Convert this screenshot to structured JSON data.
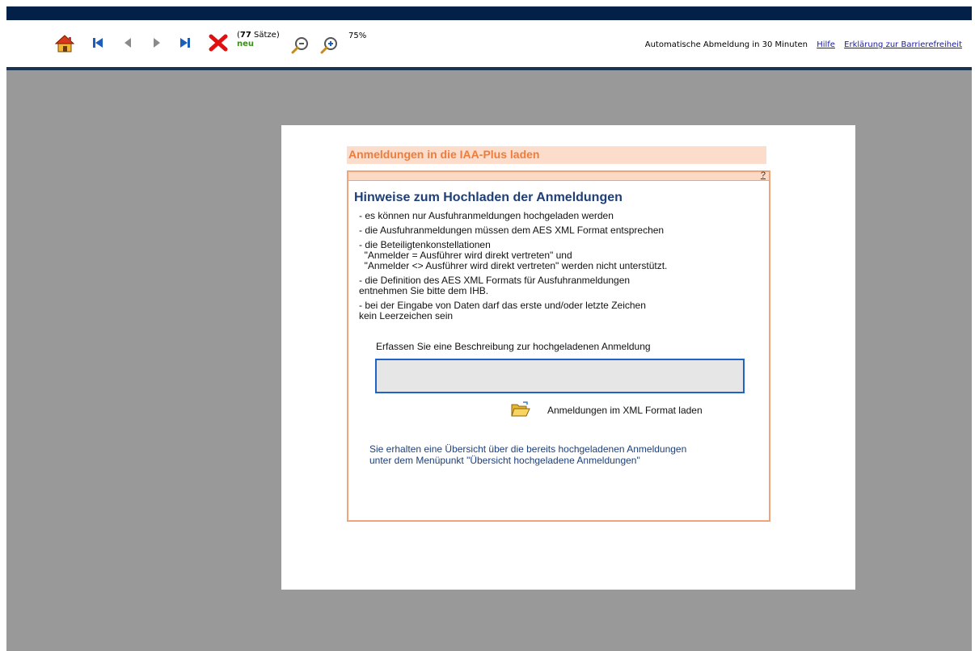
{
  "toolbar": {
    "icons": [
      "home-icon",
      "first-record-icon",
      "previous-record-icon",
      "next-record-icon",
      "last-record-icon",
      "delete-icon",
      "zoom-out-icon",
      "zoom-in-icon"
    ],
    "count_open": "(",
    "count_value": "77",
    "count_label": "Sätze)",
    "new_label": "neu",
    "zoom_level": "75%",
    "auto_logout": "Automatische Abmeldung in 30 Minuten",
    "help_link": "Hilfe",
    "accessibility_link": "Erklärung zur Barrierefreiheit"
  },
  "page": {
    "title": "Anmeldungen in die IAA-Plus laden",
    "help_marker": "?",
    "heading": "Hinweise zum Hochladen der Anmeldungen",
    "notes": [
      [
        "- es können nur Ausfuhranmeldungen hochgeladen werden"
      ],
      [
        "- die Ausfuhranmeldungen müssen dem AES XML Format entsprechen"
      ],
      [
        "- die Beteiligtenkonstellationen",
        "  \"Anmelder = Ausführer wird direkt vertreten\" und",
        "  \"Anmelder <> Ausführer wird direkt vertreten\" werden nicht unterstützt."
      ],
      [
        "- die Definition des AES XML Formats für Ausfuhranmeldungen",
        "entnehmen Sie bitte dem IHB."
      ],
      [
        "- bei der Eingabe von Daten darf das erste und/oder letzte Zeichen",
        "kein Leerzeichen sein"
      ]
    ],
    "description_label": "Erfassen Sie eine Beschreibung zur hochgeladenen Anmeldung",
    "description_value": "",
    "upload_label": "Anmeldungen im XML Format laden",
    "info_lines": [
      "Sie erhalten eine Übersicht über die bereits hochgeladenen Anmeldungen",
      "unter dem Menüpunkt \"Übersicht hochgeladene Anmeldungen\""
    ]
  },
  "colors": {
    "top_bar": "#032148",
    "workspace": "#999999",
    "title_bg": "#fcdccb",
    "title_text": "#ec7d3c",
    "heading_text": "#1e3f78",
    "input_border": "#1e63c8"
  }
}
